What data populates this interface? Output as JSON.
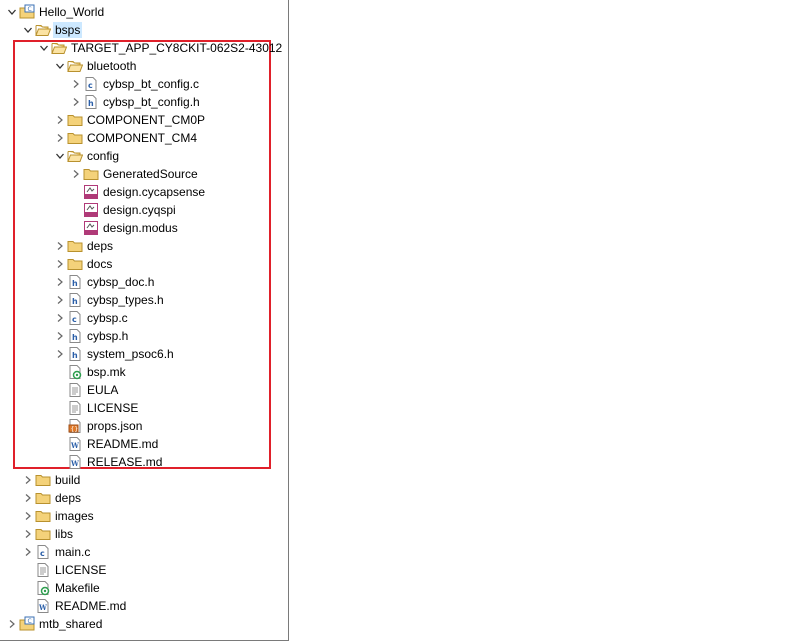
{
  "highlight_color": "#e0202a",
  "tree": [
    {
      "depth": 0,
      "chevron": "down",
      "icon": "project-icon",
      "label": "Hello_World"
    },
    {
      "depth": 1,
      "chevron": "down",
      "icon": "folder-open-icon",
      "label": "bsps",
      "selected": true
    },
    {
      "depth": 2,
      "chevron": "down",
      "icon": "folder-open-icon",
      "label": "TARGET_APP_CY8CKIT-062S2-43012"
    },
    {
      "depth": 3,
      "chevron": "down",
      "icon": "folder-open-icon",
      "label": "bluetooth"
    },
    {
      "depth": 4,
      "chevron": "right",
      "icon": "c-file-icon",
      "label": "cybsp_bt_config.c"
    },
    {
      "depth": 4,
      "chevron": "right",
      "icon": "h-file-icon",
      "label": "cybsp_bt_config.h"
    },
    {
      "depth": 3,
      "chevron": "right",
      "icon": "folder-icon",
      "label": "COMPONENT_CM0P"
    },
    {
      "depth": 3,
      "chevron": "right",
      "icon": "folder-icon",
      "label": "COMPONENT_CM4"
    },
    {
      "depth": 3,
      "chevron": "down",
      "icon": "folder-open-icon",
      "label": "config"
    },
    {
      "depth": 4,
      "chevron": "right",
      "icon": "folder-icon",
      "label": "GeneratedSource"
    },
    {
      "depth": 4,
      "chevron": "none",
      "icon": "design-file-icon",
      "label": "design.cycapsense"
    },
    {
      "depth": 4,
      "chevron": "none",
      "icon": "design-file-icon",
      "label": "design.cyqspi"
    },
    {
      "depth": 4,
      "chevron": "none",
      "icon": "design-file-icon",
      "label": "design.modus"
    },
    {
      "depth": 3,
      "chevron": "right",
      "icon": "folder-icon",
      "label": "deps"
    },
    {
      "depth": 3,
      "chevron": "right",
      "icon": "folder-icon",
      "label": "docs"
    },
    {
      "depth": 3,
      "chevron": "right",
      "icon": "h-file-icon",
      "label": "cybsp_doc.h"
    },
    {
      "depth": 3,
      "chevron": "right",
      "icon": "h-file-icon",
      "label": "cybsp_types.h"
    },
    {
      "depth": 3,
      "chevron": "right",
      "icon": "c-file-icon",
      "label": "cybsp.c"
    },
    {
      "depth": 3,
      "chevron": "right",
      "icon": "h-file-icon",
      "label": "cybsp.h"
    },
    {
      "depth": 3,
      "chevron": "right",
      "icon": "h-file-icon",
      "label": "system_psoc6.h"
    },
    {
      "depth": 3,
      "chevron": "none",
      "icon": "make-file-icon",
      "label": "bsp.mk"
    },
    {
      "depth": 3,
      "chevron": "none",
      "icon": "text-file-icon",
      "label": "EULA"
    },
    {
      "depth": 3,
      "chevron": "none",
      "icon": "text-file-icon",
      "label": "LICENSE"
    },
    {
      "depth": 3,
      "chevron": "none",
      "icon": "json-file-icon",
      "label": "props.json"
    },
    {
      "depth": 3,
      "chevron": "none",
      "icon": "word-file-icon",
      "label": "README.md"
    },
    {
      "depth": 3,
      "chevron": "none",
      "icon": "word-file-icon",
      "label": "RELEASE.md"
    },
    {
      "depth": 1,
      "chevron": "right",
      "icon": "folder-icon",
      "label": "build"
    },
    {
      "depth": 1,
      "chevron": "right",
      "icon": "folder-icon",
      "label": "deps"
    },
    {
      "depth": 1,
      "chevron": "right",
      "icon": "folder-icon",
      "label": "images"
    },
    {
      "depth": 1,
      "chevron": "right",
      "icon": "folder-icon",
      "label": "libs"
    },
    {
      "depth": 1,
      "chevron": "right",
      "icon": "c-file-icon",
      "label": "main.c"
    },
    {
      "depth": 1,
      "chevron": "none",
      "icon": "text-file-icon",
      "label": "LICENSE"
    },
    {
      "depth": 1,
      "chevron": "none",
      "icon": "make-file-icon",
      "label": "Makefile"
    },
    {
      "depth": 1,
      "chevron": "none",
      "icon": "word-file-icon",
      "label": "README.md"
    },
    {
      "depth": 0,
      "chevron": "right",
      "icon": "project-icon",
      "label": "mtb_shared"
    }
  ]
}
